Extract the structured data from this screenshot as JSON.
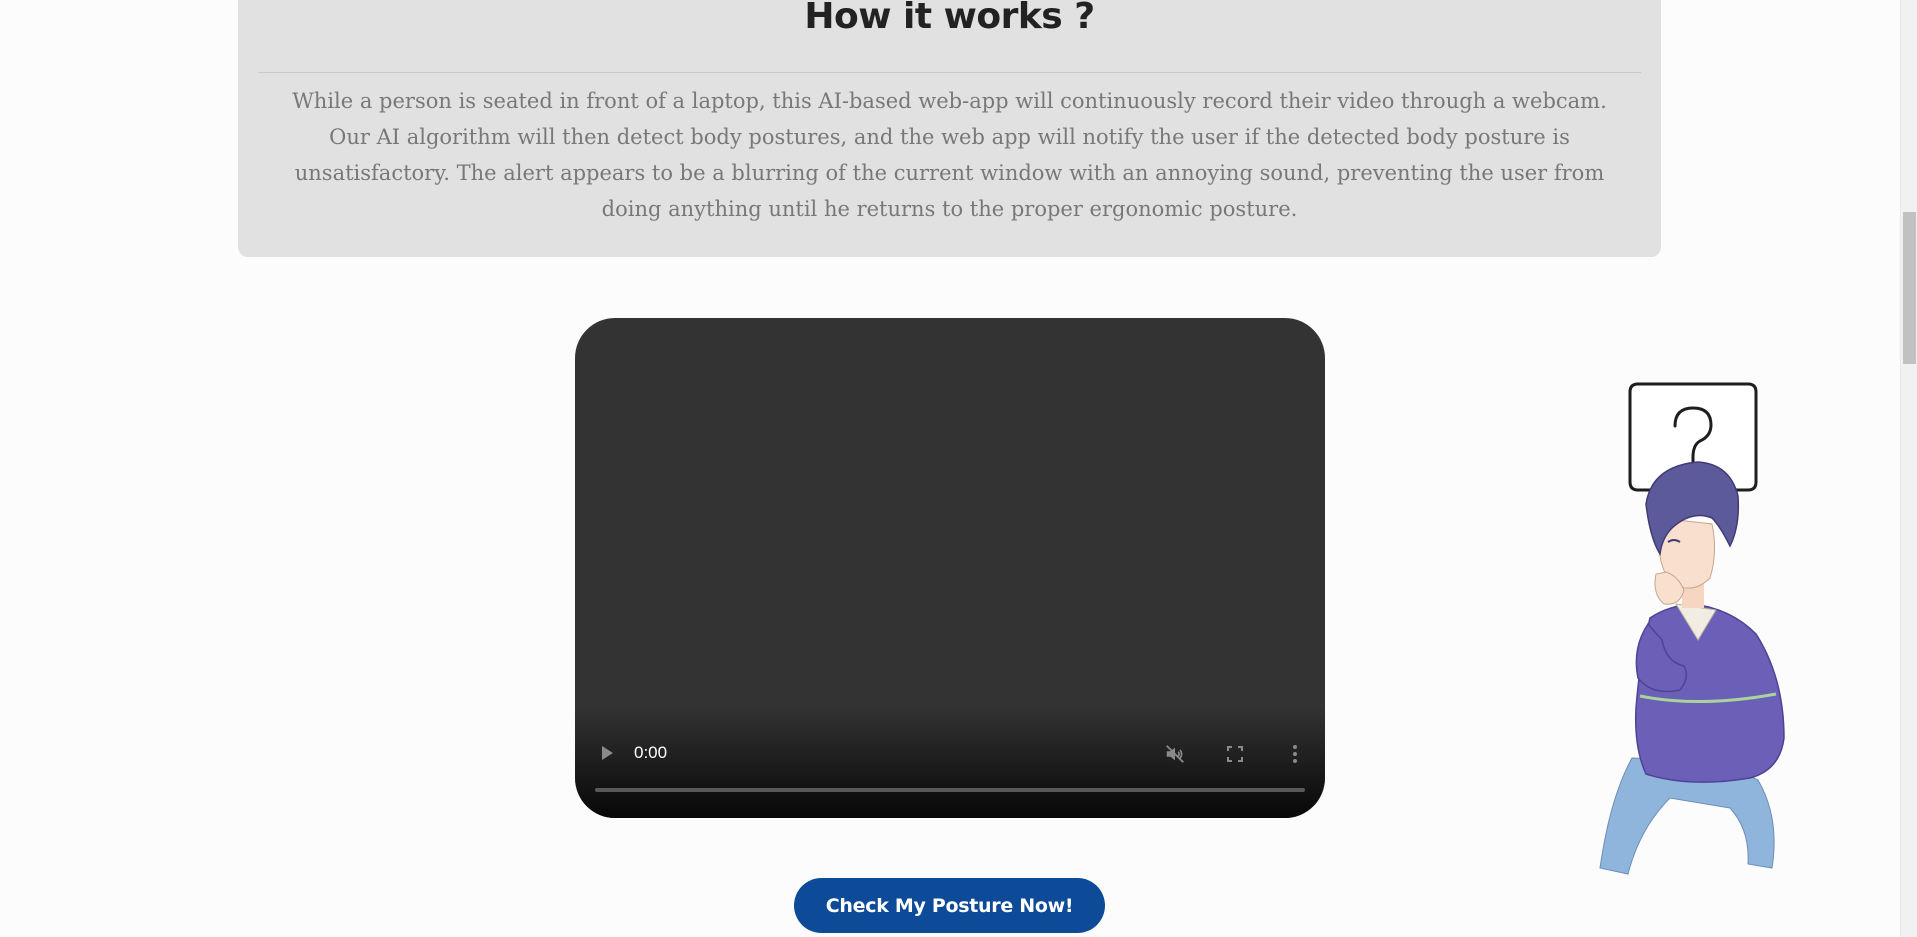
{
  "how_it_works": {
    "title": "How it works ?",
    "description": "While a person is seated in front of a laptop, this AI-based web-app will continuously record their video through a webcam. Our AI algorithm will then detect body postures, and the web app will notify the user if the detected body posture is unsatisfactory. The alert appears to be a blurring of the current window with an annoying sound, preventing the user from doing anything until he returns to the proper ergonomic posture."
  },
  "video_player": {
    "current_time": "0:00",
    "progress": 0,
    "icons": {
      "play": "play-icon",
      "mute": "muted-speaker-icon",
      "fullscreen": "fullscreen-icon",
      "more": "more-vertical-icon"
    }
  },
  "cta": {
    "label": "Check My Posture Now!"
  },
  "illustration": {
    "icon": "question-mark-speech-bubble-icon"
  },
  "colors": {
    "card_background": "#e1e1e1",
    "video_background": "#333333",
    "button_background": "#0d4a98",
    "body_text": "#787878",
    "title_text": "#222222"
  }
}
